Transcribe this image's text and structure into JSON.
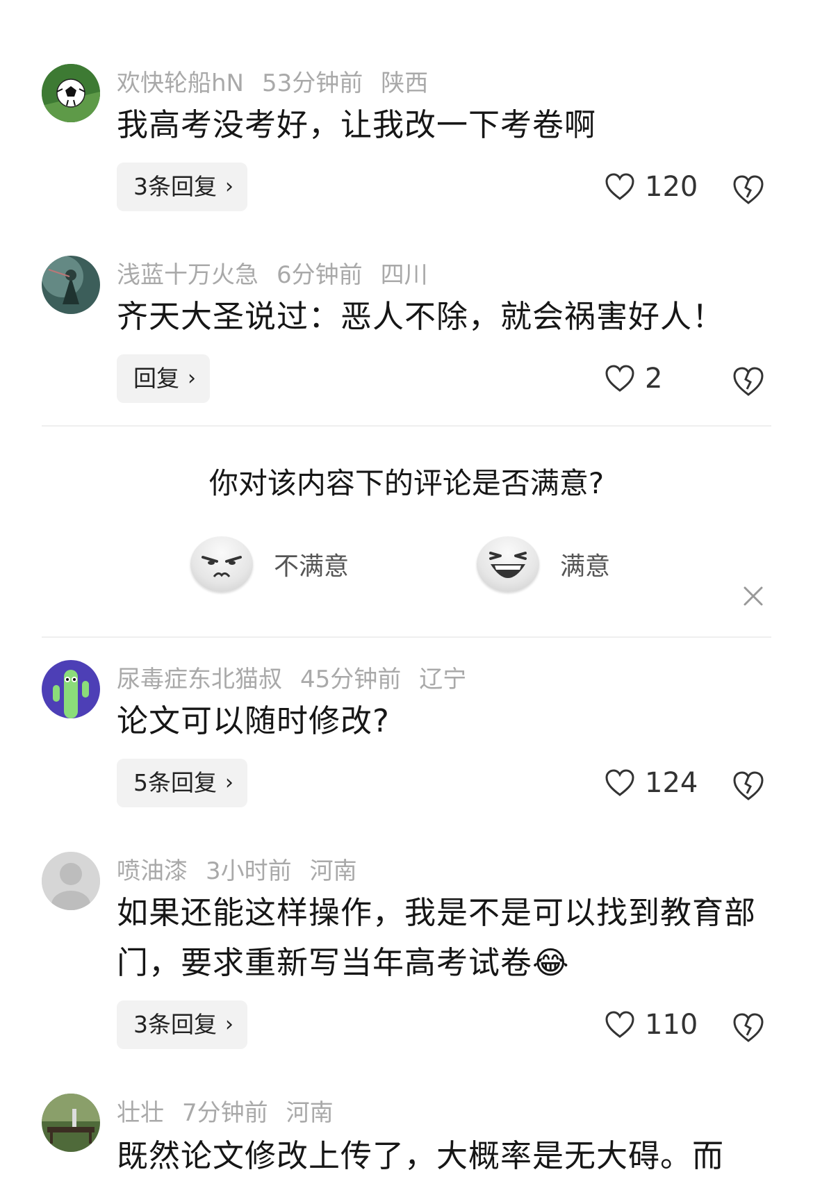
{
  "comments": [
    {
      "user": "欢快轮船hN",
      "time": "53分钟前",
      "location": "陕西",
      "text": "我高考没考好，让我改一下考卷啊",
      "reply": "3条回复",
      "likes": "120"
    },
    {
      "user": "浅蓝十万火急",
      "time": "6分钟前",
      "location": "四川",
      "text": "齐天大圣说过：恶人不除，就会祸害好人！",
      "reply": "回复",
      "likes": "2"
    },
    {
      "user": "尿毒症东北猫叔",
      "time": "45分钟前",
      "location": "辽宁",
      "text": "论文可以随时修改?",
      "reply": "5条回复",
      "likes": "124"
    },
    {
      "user": "喷油漆",
      "time": "3小时前",
      "location": "河南",
      "text": "如果还能这样操作，我是不是可以找到教育部门，要求重新写当年高考试卷😂",
      "reply": "3条回复",
      "likes": "110"
    },
    {
      "user": "壮壮",
      "time": "7分钟前",
      "location": "河南",
      "text": "既然论文修改上传了，大概率是无大碍。而"
    }
  ],
  "survey": {
    "question": "你对该内容下的评论是否满意?",
    "unsatisfied": "不满意",
    "satisfied": "满意"
  },
  "icons": {
    "like": "heart-outline",
    "dislike": "broken-heart-outline",
    "close": "close-x"
  },
  "colors": {
    "meta": "#a9a9a9",
    "text": "#161616",
    "reply_bg": "#f2f2f2"
  }
}
